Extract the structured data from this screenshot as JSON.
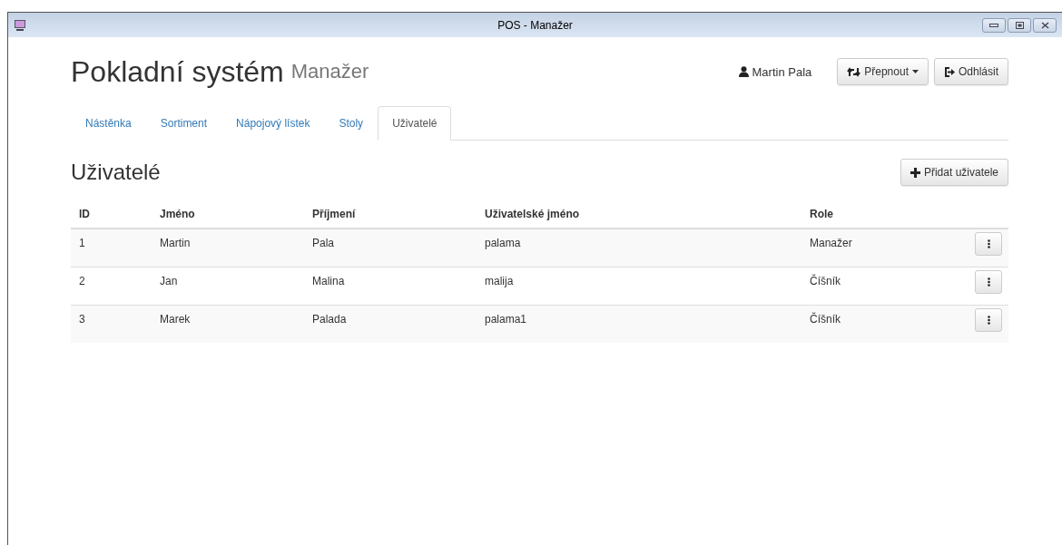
{
  "window": {
    "title": "POS - Manažer"
  },
  "header": {
    "title": "Pokladní systém",
    "subtitle": "Manažer",
    "user": "Martin Pala",
    "buttons": [
      {
        "kind": "switch",
        "label": "Přepnout"
      },
      {
        "kind": "logout",
        "label": "Odhlásit"
      }
    ]
  },
  "tabs": [
    {
      "label": "Nástěnka",
      "selected": false
    },
    {
      "label": "Sortiment",
      "selected": false
    },
    {
      "label": "Nápojový lístek",
      "selected": false
    },
    {
      "label": "Stoly",
      "selected": false
    },
    {
      "label": "Uživatelé",
      "selected": true
    }
  ],
  "section": {
    "title": "Uživatelé",
    "add_button": "Přidat uživatele"
  },
  "table": {
    "columns": [
      "ID",
      "Jméno",
      "Příjmení",
      "Uživatelské jméno",
      "Role"
    ],
    "rows": [
      {
        "cells": [
          "1",
          "Martin",
          "Pala",
          "palama",
          "Manažer"
        ]
      },
      {
        "cells": [
          "2",
          "Jan",
          "Malina",
          "malija",
          "Číšník"
        ]
      },
      {
        "cells": [
          "3",
          "Marek",
          "Palada",
          "palama1",
          "Číšník"
        ]
      }
    ]
  }
}
